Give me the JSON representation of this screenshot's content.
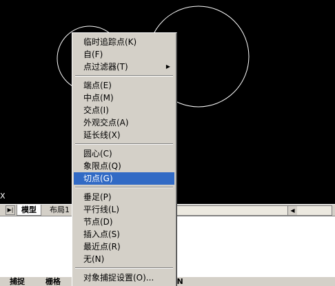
{
  "ucs_icon": "X",
  "tabs": {
    "nav_icon": "tab-nav-icon",
    "model": "模型",
    "layout1": "布局1"
  },
  "status": {
    "item1": "捕捉",
    "item2": "栅格",
    "item3": "AN"
  },
  "menu": {
    "g1": [
      "临时追踪点(K)",
      "自(F)",
      "点过滤器(T)"
    ],
    "g2": [
      "端点(E)",
      "中点(M)",
      "交点(I)",
      "外观交点(A)",
      "延长线(X)"
    ],
    "g3": [
      "圆心(C)",
      "象限点(Q)",
      "切点(G)"
    ],
    "g4": [
      "垂足(P)",
      "平行线(L)",
      "节点(D)",
      "插入点(S)",
      "最近点(R)",
      "无(N)"
    ],
    "g5": [
      "对象捕捉设置(O)..."
    ]
  },
  "colors": {
    "selection": "#316ac5",
    "drawing_background": "#000000",
    "circle_stroke": "#ffffff"
  }
}
